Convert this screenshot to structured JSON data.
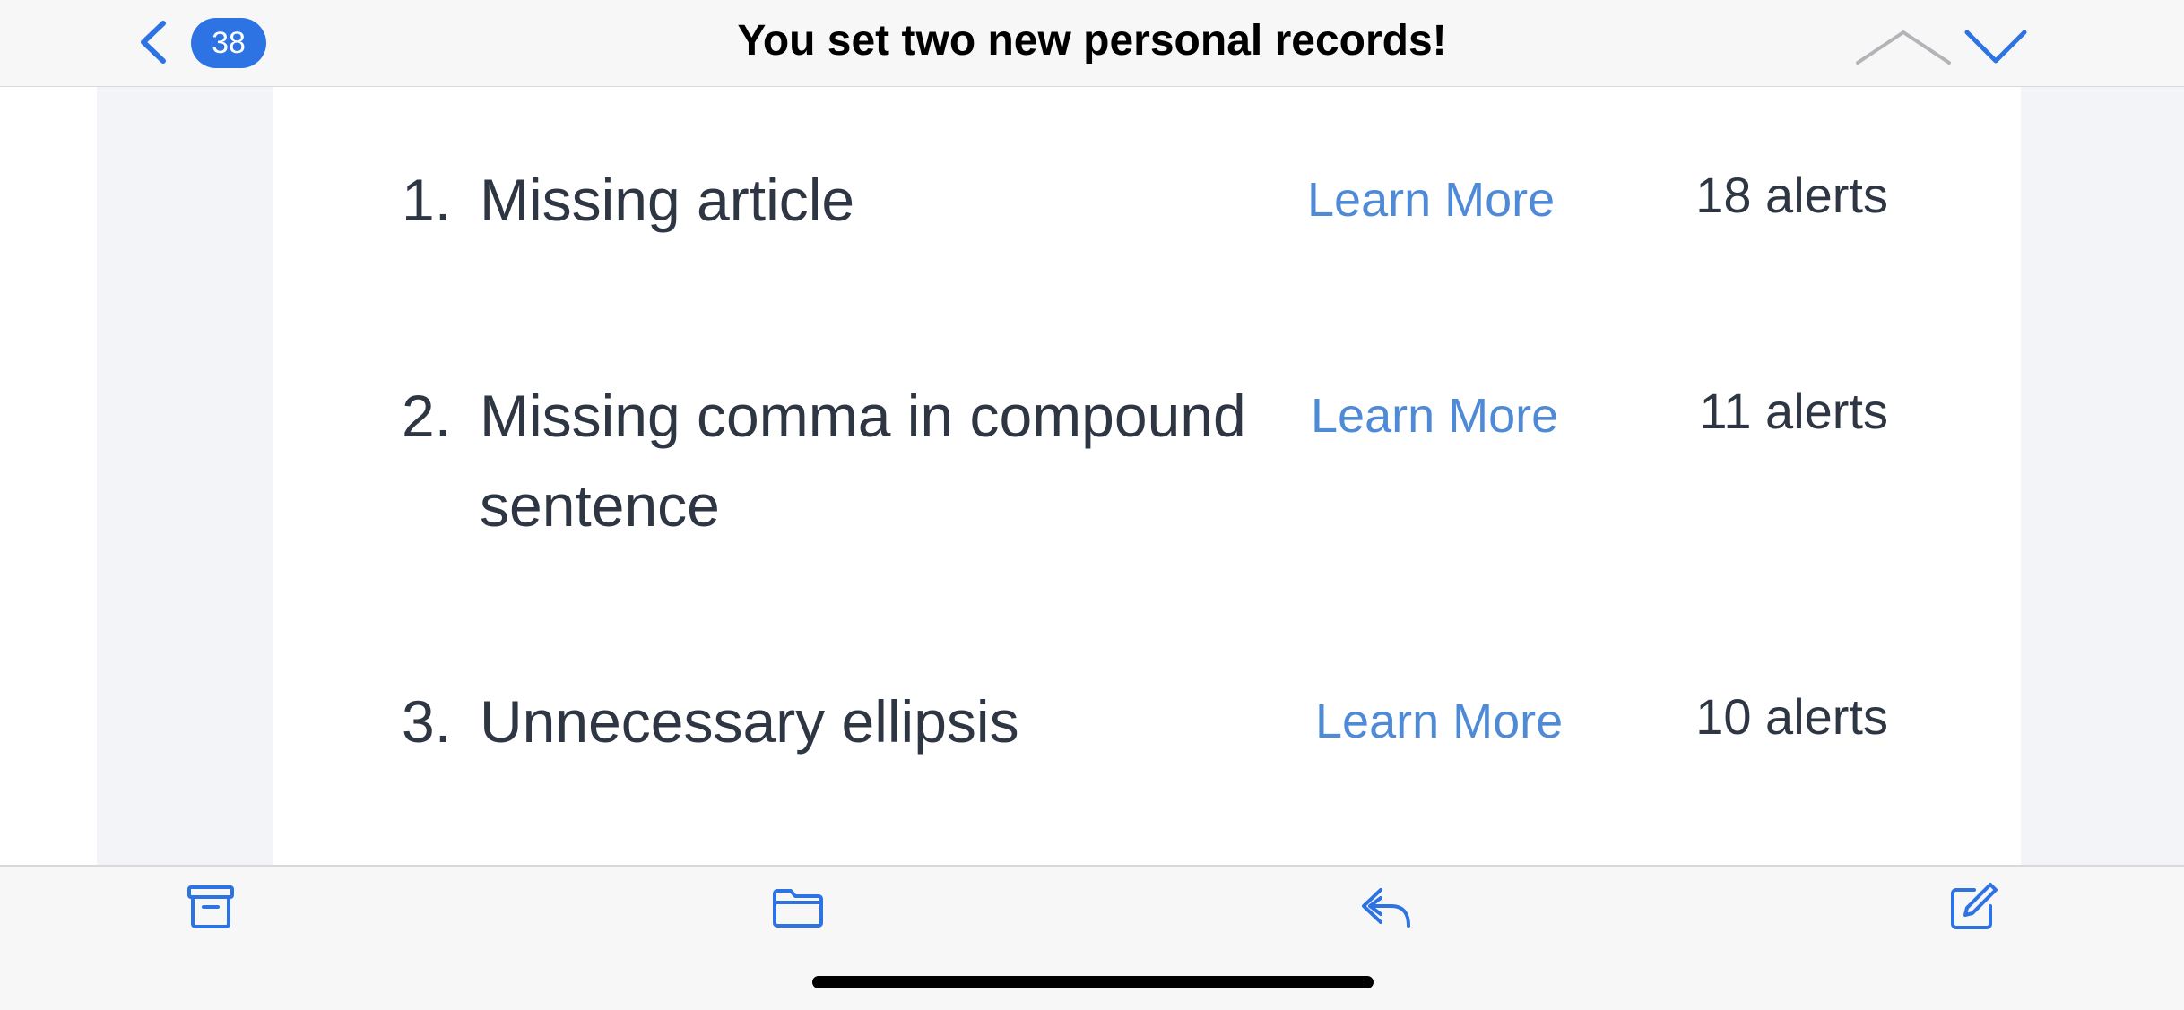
{
  "header": {
    "title": "You set two new personal records!",
    "unread_count": "38"
  },
  "items": [
    {
      "number": "1.",
      "title": "Missing article",
      "link_label": "Learn More",
      "alerts": "18 alerts"
    },
    {
      "number": "2.",
      "title": "Missing comma in compound sentence",
      "link_label": "Learn More",
      "alerts": "11 alerts"
    },
    {
      "number": "3.",
      "title": "Unnecessary ellipsis",
      "link_label": "Learn More",
      "alerts": "10 alerts"
    }
  ],
  "toolbar": {
    "icons": [
      "archive-icon",
      "folder-icon",
      "reply-icon",
      "compose-icon"
    ]
  },
  "colors": {
    "accent": "#2d73e3",
    "link": "#4f8ad6",
    "text": "#2f3643",
    "bar_background": "#f7f7f8",
    "side_panel": "#f3f4f8"
  }
}
